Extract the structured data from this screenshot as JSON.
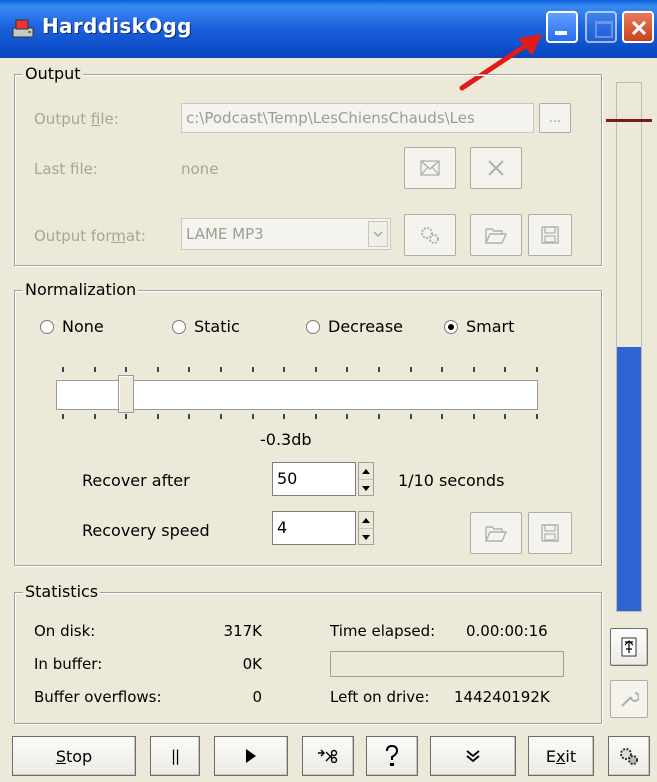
{
  "window": {
    "title": "HarddiskOgg"
  },
  "output": {
    "group_label": "Output",
    "file_label_pre": "Output ",
    "file_label_u": "f",
    "file_label_post": "ile:",
    "file_value": "c:\\Podcast\\Temp\\LesChiensChauds\\Les",
    "browse_label": "...",
    "last_label": "Last file:",
    "last_value": "none",
    "format_label_pre": "Output for",
    "format_label_u": "m",
    "format_label_post": "at:",
    "format_value": "LAME MP3"
  },
  "normalization": {
    "group_label": "Normalization",
    "options": [
      "None",
      "Static",
      "Decrease",
      "Smart"
    ],
    "selected": "Smart",
    "slider_value_label": "-0.3db",
    "recover_label": "Recover after",
    "recover_value": "50",
    "recover_unit": "1/10 seconds",
    "speed_label": "Recovery speed",
    "speed_value": "4"
  },
  "statistics": {
    "group_label": "Statistics",
    "on_disk_label": "On disk:",
    "on_disk_value": "317K",
    "in_buffer_label": "In buffer:",
    "in_buffer_value": "0K",
    "overflows_label": "Buffer overflows:",
    "overflows_value": "0",
    "elapsed_label": "Time elapsed:",
    "elapsed_value": "0.00:00:16",
    "left_label": "Left on drive:",
    "left_value": "144240192K"
  },
  "level_meter": {
    "fill_fraction": 0.5
  },
  "bottom_bar": {
    "stop_label_u": "S",
    "stop_label_rest": "top",
    "pause_label": "||",
    "exit_label_pre": "E",
    "exit_label_u": "x",
    "exit_label_post": "it"
  },
  "colors": {
    "titlebar": "#0b4cc8",
    "meter": "#2f64d1",
    "annotation_arrow": "#e01b1b"
  }
}
